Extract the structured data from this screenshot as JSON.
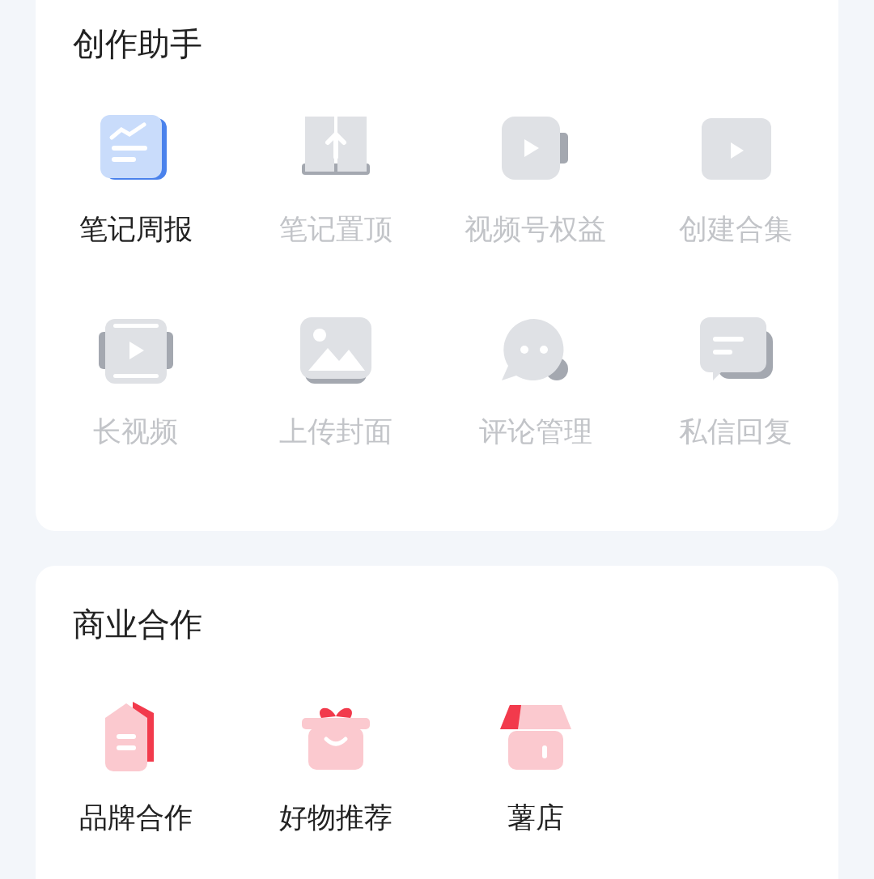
{
  "sections": [
    {
      "title": "创作助手",
      "items": [
        {
          "label": "笔记周报",
          "disabled": false
        },
        {
          "label": "笔记置顶",
          "disabled": true
        },
        {
          "label": "视频号权益",
          "disabled": true
        },
        {
          "label": "创建合集",
          "disabled": true
        },
        {
          "label": "长视频",
          "disabled": true
        },
        {
          "label": "上传封面",
          "disabled": true
        },
        {
          "label": "评论管理",
          "disabled": true
        },
        {
          "label": "私信回复",
          "disabled": true
        }
      ]
    },
    {
      "title": "商业合作",
      "items": [
        {
          "label": "品牌合作",
          "disabled": false
        },
        {
          "label": "好物推荐",
          "disabled": false
        },
        {
          "label": "薯店",
          "disabled": false
        }
      ]
    }
  ]
}
